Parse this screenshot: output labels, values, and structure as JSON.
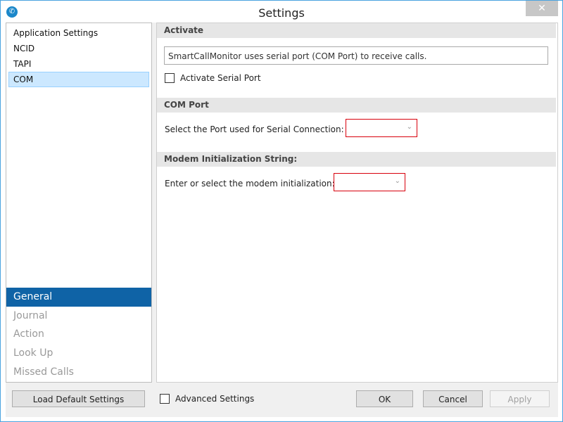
{
  "window": {
    "title": "Settings",
    "close_glyph": "✕",
    "app_icon": "phone-icon"
  },
  "tree": {
    "items": [
      {
        "label": "Application Settings",
        "selected": false
      },
      {
        "label": "NCID",
        "selected": false
      },
      {
        "label": "TAPI",
        "selected": false
      },
      {
        "label": "COM",
        "selected": true
      }
    ]
  },
  "nav": {
    "items": [
      {
        "label": "General",
        "active": true
      },
      {
        "label": "Journal",
        "active": false
      },
      {
        "label": "Action",
        "active": false
      },
      {
        "label": "Look Up",
        "active": false
      },
      {
        "label": "Missed Calls",
        "active": false
      }
    ]
  },
  "sections": {
    "activate": {
      "header": "Activate",
      "info_text": "SmartCallMonitor uses serial port (COM Port) to receive calls.",
      "checkbox_label": "Activate Serial Port",
      "checked": false
    },
    "com_port": {
      "header": "COM Port",
      "label": "Select the Port used for Serial Connection:",
      "value": ""
    },
    "modem": {
      "header": "Modem Initialization String:",
      "label": "Enter or select the modem initialization:",
      "value": ""
    }
  },
  "footer": {
    "load_default": "Load Default Settings",
    "advanced": "Advanced Settings",
    "advanced_checked": false,
    "ok": "OK",
    "cancel": "Cancel",
    "apply": "Apply"
  },
  "colors": {
    "accent": "#0f63a6",
    "selection": "#cce8ff",
    "error_border": "#d8000c"
  }
}
